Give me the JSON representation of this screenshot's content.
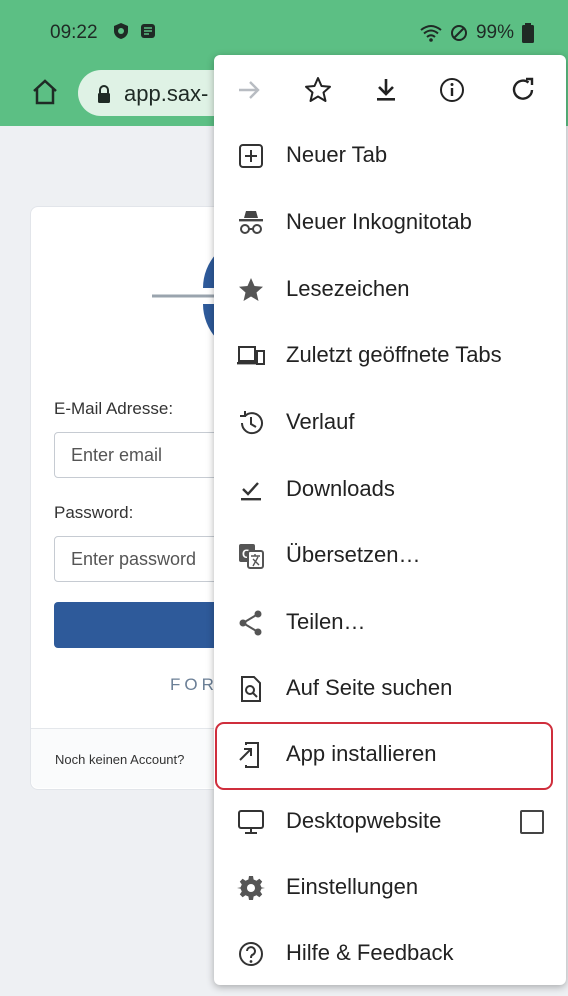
{
  "status": {
    "time": "09:22",
    "battery": "99%"
  },
  "browser": {
    "url_text": "app.sax-"
  },
  "login": {
    "email_label": "E-Mail Adresse:",
    "email_placeholder": "Enter email",
    "password_label": "Password:",
    "password_placeholder": "Enter password",
    "forgot_fragment": "FOR",
    "no_account_text": "Noch keinen Account?"
  },
  "menu": {
    "top_icons": [
      "forward-icon",
      "star-icon",
      "download-icon",
      "info-icon",
      "reload-icon"
    ],
    "items": [
      {
        "label": "Neuer Tab",
        "icon": "new-tab-icon"
      },
      {
        "label": "Neuer Inkognitotab",
        "icon": "incognito-icon"
      },
      {
        "label": "Lesezeichen",
        "icon": "bookmarks-star-icon"
      },
      {
        "label": "Zuletzt geöffnete Tabs",
        "icon": "recent-tabs-devices-icon"
      },
      {
        "label": "Verlauf",
        "icon": "history-icon"
      },
      {
        "label": "Downloads",
        "icon": "downloads-check-icon"
      },
      {
        "label": "Übersetzen…",
        "icon": "translate-icon"
      },
      {
        "label": "Teilen…",
        "icon": "share-icon"
      },
      {
        "label": "Auf Seite suchen",
        "icon": "find-in-page-icon"
      },
      {
        "label": "App installieren",
        "icon": "install-app-icon"
      },
      {
        "label": "Desktopwebsite",
        "icon": "desktop-icon"
      },
      {
        "label": "Einstellungen",
        "icon": "settings-gear-icon"
      },
      {
        "label": "Hilfe & Feedback",
        "icon": "help-icon"
      }
    ],
    "highlighted_item": "App installieren",
    "desktop_checkbox_checked": false
  },
  "colors": {
    "toolbar": "#5cbf84",
    "highlight": "#cf2e3c",
    "button": "#2e5a9a"
  }
}
